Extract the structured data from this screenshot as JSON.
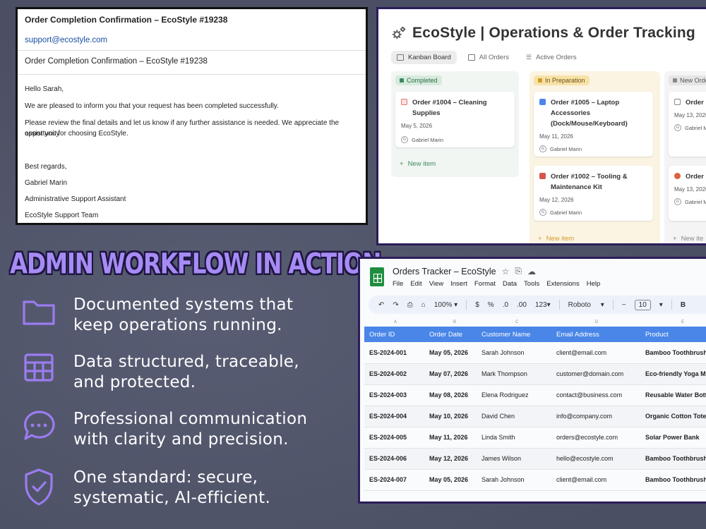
{
  "email": {
    "subject_top": "Order Completion Confirmation – EcoStyle #19238",
    "from": "support@ecostyle.com",
    "subject": "Order Completion Confirmation – EcoStyle #19238",
    "greeting": "Hello Sarah,",
    "p1": "We are pleased to inform you that your request has been completed successfully.",
    "p2a": "Please review the final details and let us know if any further assistance is needed. We appreciate the opportunity",
    "p2b": "assist you for choosing EcoStyle.",
    "signoff": "Best regards,",
    "name": "Gabriel Marin",
    "role": "Administrative Support Assistant",
    "team": "EcoStyle Support Team"
  },
  "kanban": {
    "title": "EcoStyle | Operations & Order Tracking",
    "tabs": [
      "Kanban Board",
      "All Orders",
      "Active Orders"
    ],
    "columns": [
      {
        "label": "Completed",
        "cards": [
          {
            "name": "Order #1004 – Cleaning Supplies",
            "date": "May 5, 2026",
            "user": "Gabriel Marin"
          }
        ],
        "new_item": "New item"
      },
      {
        "label": "In Preparation",
        "cards": [
          {
            "name": "Order #1005 – Laptop Accessories (Dock/Mouse/Keyboard)",
            "date": "May 11, 2026",
            "user": "Gabriel Marin"
          },
          {
            "name": "Order #1002 – Tooling & Maintenance Kit",
            "date": "May 12, 2026",
            "user": "Gabriel Marin"
          }
        ],
        "new_item": "New item"
      },
      {
        "label": "New Order",
        "cards": [
          {
            "name": "Order Bundle (Pens/",
            "date": "May 13, 2026",
            "user": "Gabriel M"
          },
          {
            "name": "Order Restoc",
            "date": "May 13, 2026",
            "user": "Gabriel M"
          }
        ],
        "new_item": "New ite"
      }
    ]
  },
  "headline": "ADMIN WORKFLOW IN ACTION",
  "features": [
    {
      "icon": "folder-icon",
      "line1": "Documented systems that",
      "line2": "keep operations running."
    },
    {
      "icon": "table-icon",
      "line1": "Data structured, traceable,",
      "line2": "and protected."
    },
    {
      "icon": "chat-icon",
      "line1": "Professional communication",
      "line2": "with clarity and precision."
    },
    {
      "icon": "shield-check-icon",
      "line1": "One standard: secure,",
      "line2": "systematic, AI-efficient."
    }
  ],
  "sheet": {
    "title": "Orders Tracker – EcoStyle",
    "menus": [
      "File",
      "Edit",
      "View",
      "Insert",
      "Format",
      "Data",
      "Tools",
      "Extensions",
      "Help"
    ],
    "toolbar": {
      "zoom": "100%",
      "currency": "$",
      "percent": "%",
      "dec_less": ".0",
      "dec_more": ".00",
      "num_format": "123",
      "font": "Roboto",
      "font_size": "10",
      "bold": "B"
    },
    "column_letters": [
      "A",
      "B",
      "C",
      "D",
      "E"
    ],
    "headers": [
      "Order ID",
      "Order Date",
      "Customer Name",
      "Email Address",
      "Product"
    ],
    "rows": [
      [
        "ES-2024-001",
        "May 05, 2026",
        "Sarah Johnson",
        "client@email.com",
        "Bamboo Toothbrush"
      ],
      [
        "ES-2024-002",
        "May 07, 2026",
        "Mark Thompson",
        "customer@domain.com",
        "Eco-friendly Yoga M"
      ],
      [
        "ES-2024-003",
        "May 08, 2026",
        "Elena Rodriguez",
        "contact@business.com",
        "Reusable Water Bott"
      ],
      [
        "ES-2024-004",
        "May 10, 2026",
        "David Chen",
        "info@company.com",
        "Organic Cotton Tote"
      ],
      [
        "ES-2024-005",
        "May 11, 2026",
        "Linda Smith",
        "orders@ecostyle.com",
        "Solar Power Bank"
      ],
      [
        "ES-2024-006",
        "May 12, 2026",
        "James Wilson",
        "hello@ecostyle.com",
        "Bamboo Toothbrush"
      ],
      [
        "ES-2024-007",
        "May 05, 2026",
        "Sarah Johnson",
        "client@email.com",
        "Bamboo Toothbrush"
      ]
    ]
  },
  "colors": {
    "background": "#4b4f63",
    "headline_fill": "#a78bf5",
    "headline_outline": "#1d1640",
    "icon_stroke": "#9b7cf0",
    "sheet_header": "#4a86e8",
    "panel_border": "#2b1d5a"
  }
}
